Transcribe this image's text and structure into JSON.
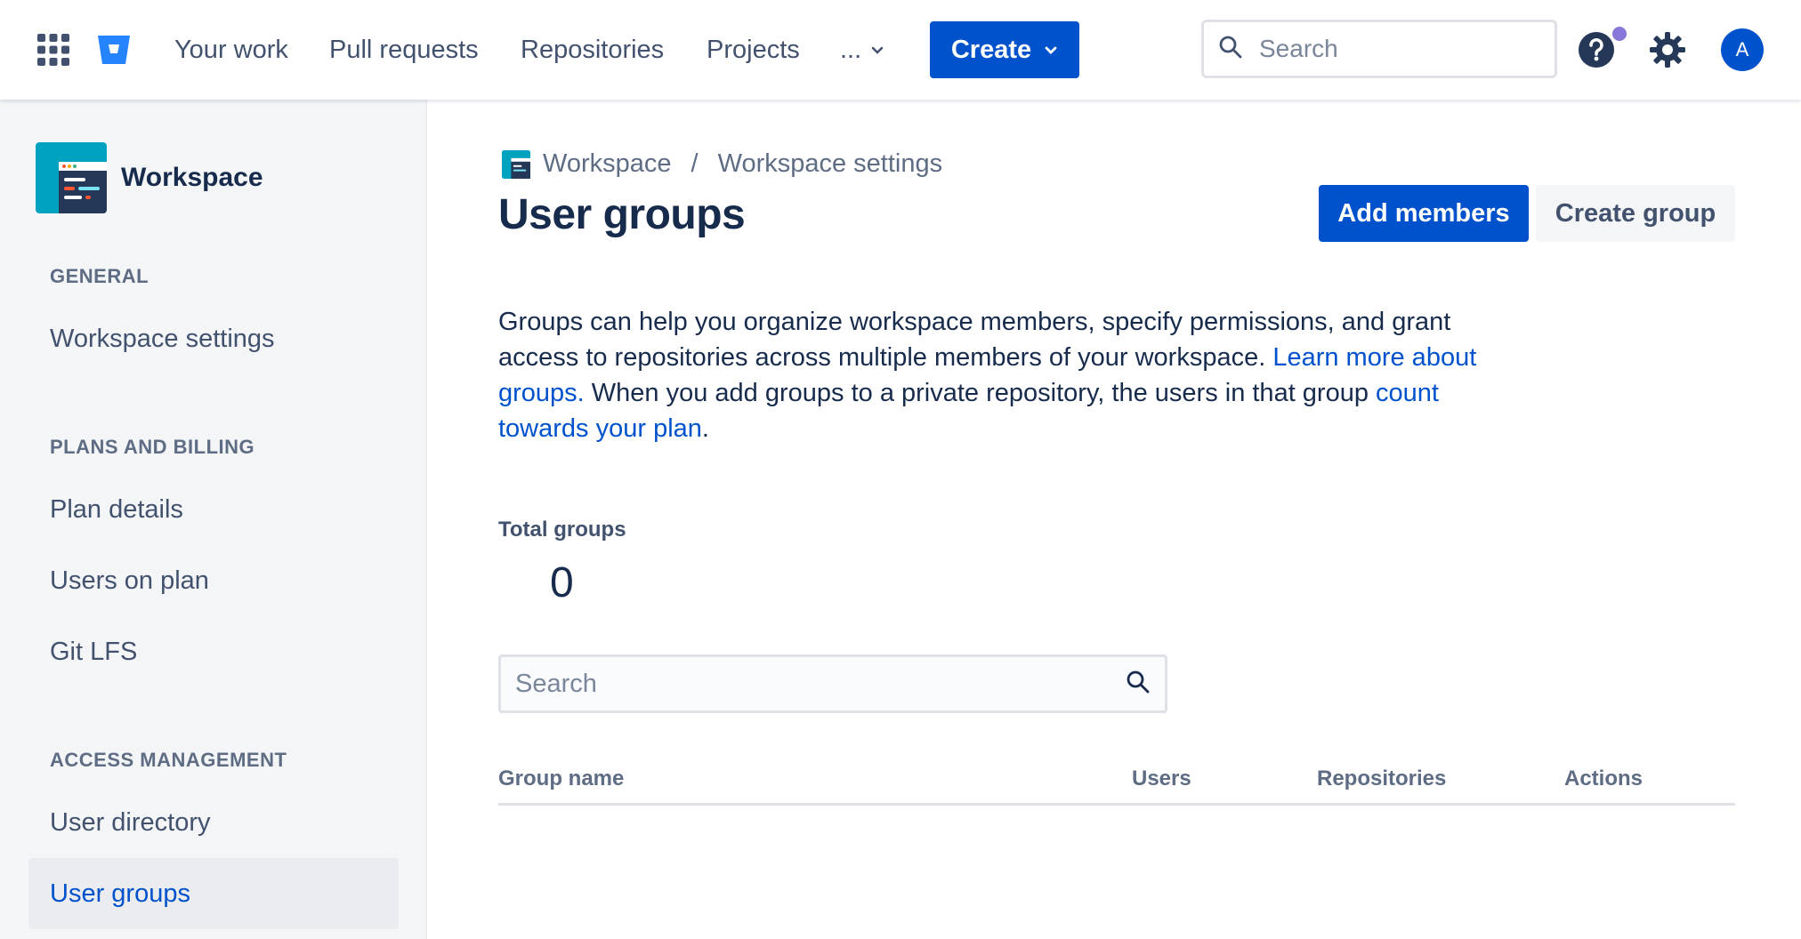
{
  "topnav": {
    "items": [
      "Your work",
      "Pull requests",
      "Repositories",
      "Projects"
    ],
    "more_label": "...",
    "create_label": "Create",
    "search_placeholder": "Search",
    "avatar_initial": "A",
    "brand_color": "#0052cc",
    "notification_dot_color": "#8777d9"
  },
  "sidebar": {
    "workspace_name": "Workspace",
    "sections": [
      {
        "heading": "GENERAL",
        "items": [
          "Workspace settings"
        ]
      },
      {
        "heading": "PLANS AND BILLING",
        "items": [
          "Plan details",
          "Users on plan",
          "Git LFS"
        ]
      },
      {
        "heading": "ACCESS MANAGEMENT",
        "items": [
          "User directory",
          "User groups"
        ]
      }
    ],
    "active_item": "User groups"
  },
  "breadcrumb": {
    "workspace": "Workspace",
    "separator": "/",
    "settings": "Workspace settings"
  },
  "page": {
    "title": "User groups",
    "add_members_label": "Add members",
    "create_group_label": "Create group",
    "description": {
      "part1": "Groups can help you organize workspace members, specify permissions, and grant access to repositories across multiple members of your workspace. ",
      "link1": "Learn more about groups.",
      "part2": " When you add groups to a private repository, the users in that group ",
      "link2": "count towards your plan",
      "part3": "."
    },
    "total_groups_label": "Total groups",
    "total_groups_value": "0",
    "search_placeholder": "Search",
    "table_columns": [
      "Group name",
      "Users",
      "Repositories",
      "Actions"
    ]
  }
}
